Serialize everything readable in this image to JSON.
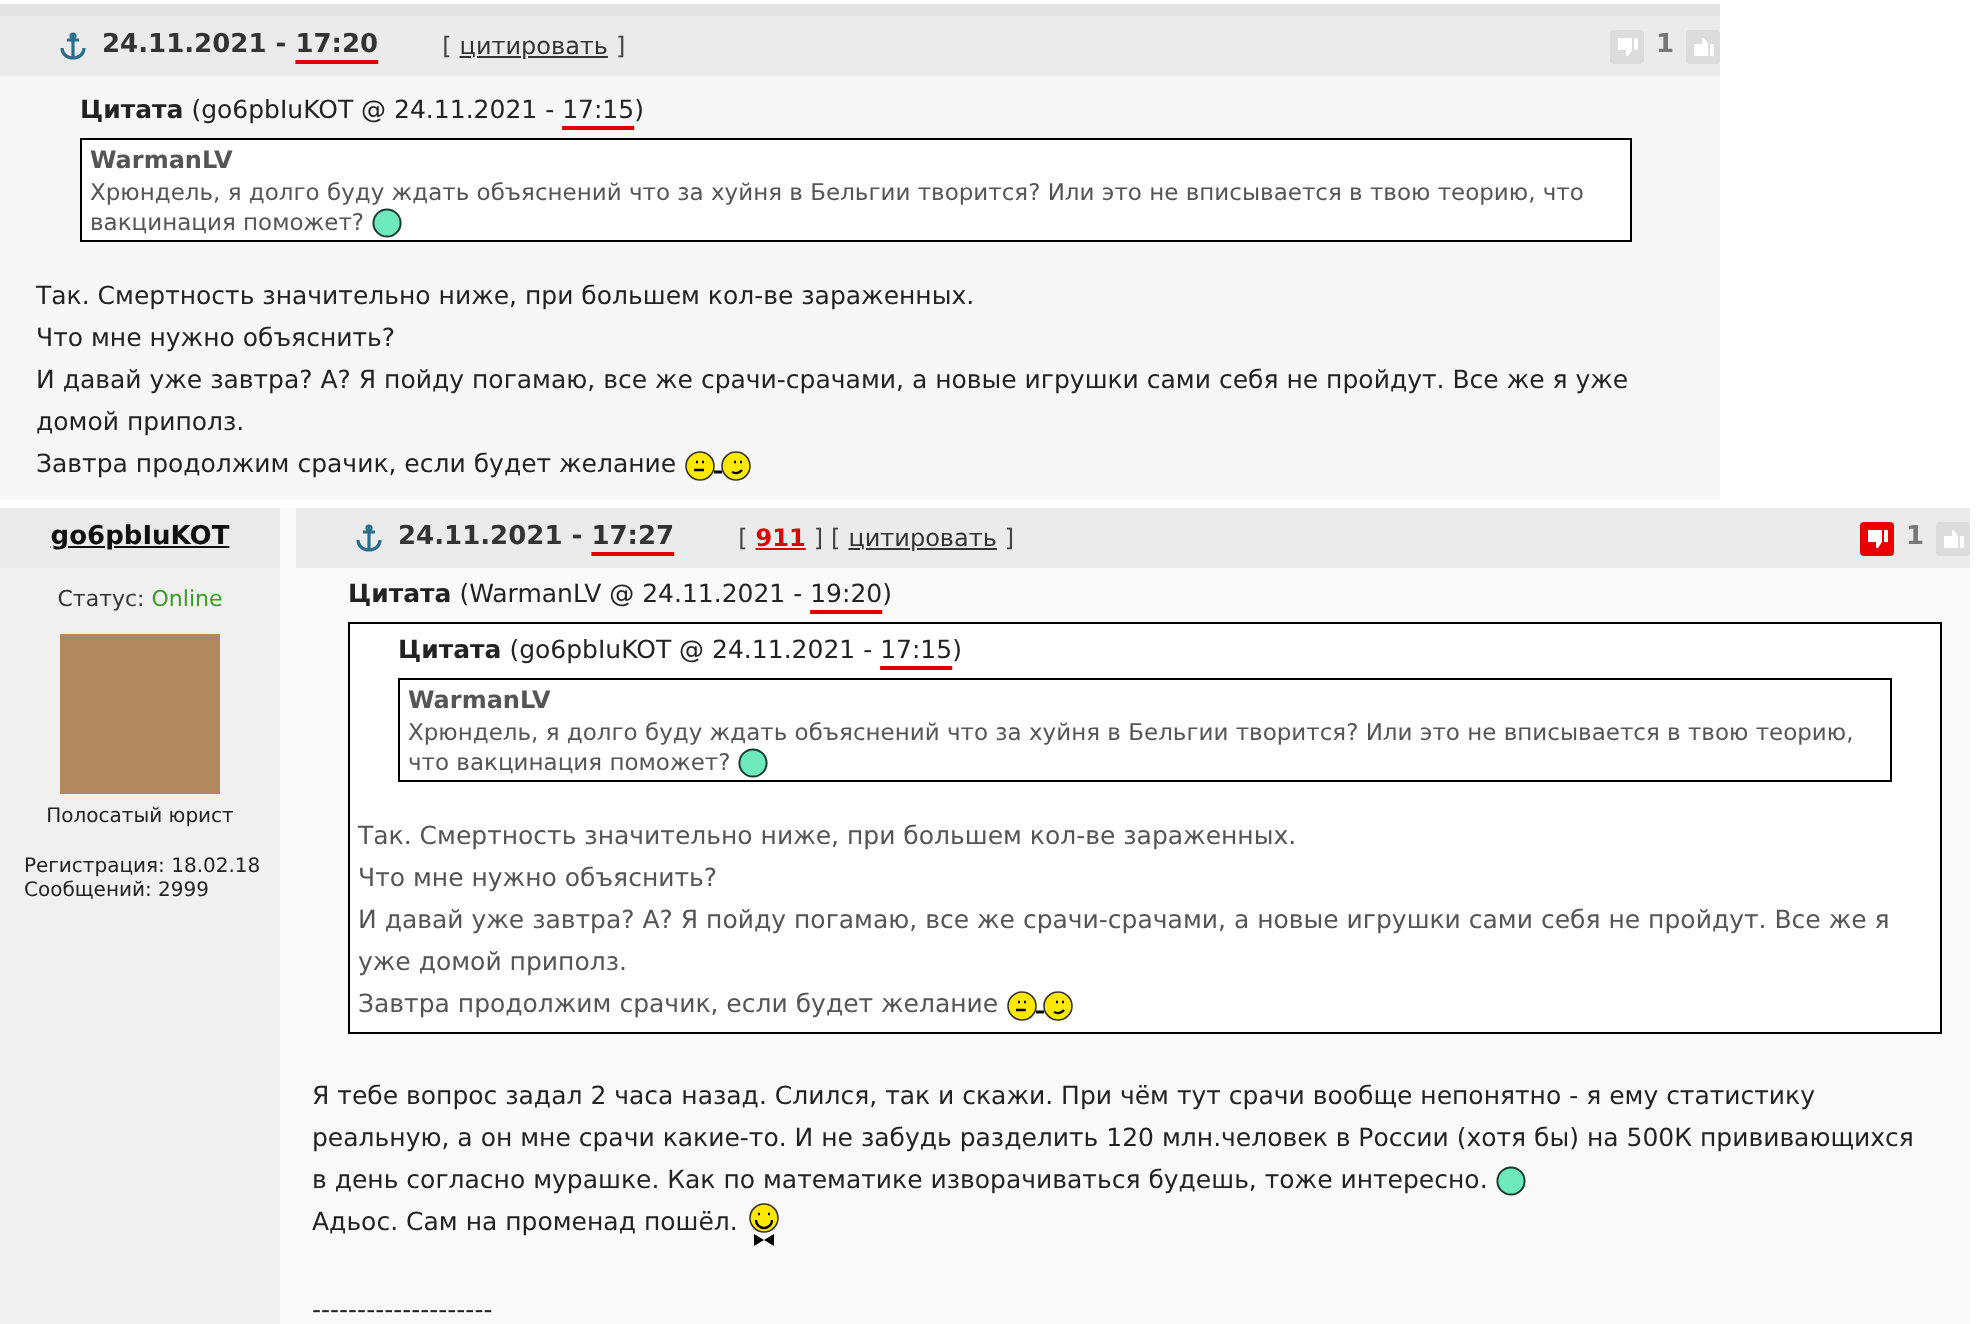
{
  "posts": [
    {
      "date": "24.11.2021 -",
      "time": "17:20",
      "actions": [
        {
          "before": "[",
          "label": "цитировать",
          "after": "]",
          "kind": "quote"
        }
      ],
      "disliked": false,
      "rating": "1",
      "quote": {
        "label": "Цитата",
        "attribution_start": "(go6pbIuKOT @ 24.11.2021 - ",
        "time": "17:15",
        "attribution_end": ")",
        "box": {
          "author": "WarmanLV",
          "lines": [
            {
              "text": "Хрюндель, я долго буду ждать объяснений что за хуйня в Бельгии творится? Или это не вписывается в твою теорию, что вакцинация поможет?",
              "emoticon": {
                "kind": "round"
              }
            }
          ]
        }
      },
      "body": [
        {
          "text": "Так. Смертность значительно ниже, при большем кол-ве зараженных."
        },
        {
          "text": "Что мне нужно объяснить?"
        },
        {
          "text": "И давай уже завтра? А? Я пойду погамаю, все же срачи-срачами, а новые игрушки сами себя не пройдут. Все же я уже домой приполз."
        },
        {
          "text": "Завтра продолжим срачик, если будет желание",
          "emoticon": {
            "kind": "two_faces"
          }
        }
      ]
    },
    {
      "author": {
        "name": "go6pbIuKOT",
        "status_label": "Статус:",
        "status": "Online",
        "title": "Полосатый юрист",
        "registration": "Регистрация: 18.02.18",
        "posts": "Сообщений: 2999"
      },
      "date": "24.11.2021 -",
      "time": "17:27",
      "actions": [
        {
          "before": "[",
          "label": "911",
          "after": "]",
          "kind": "count"
        },
        {
          "before": "[",
          "label": "цитировать",
          "after": "]",
          "kind": "quote"
        }
      ],
      "disliked": true,
      "rating": "1",
      "quote": {
        "label": "Цитата",
        "attribution_start": "(WarmanLV @ 24.11.2021 - ",
        "time": "19:20",
        "attribution_end": ")",
        "box": {
          "quote": {
            "label": "Цитата",
            "attribution_start": "(go6pbIuKOT @ 24.11.2021 - ",
            "time": "17:15",
            "attribution_end": ")",
            "box": {
              "author": "WarmanLV",
              "lines": [
                {
                  "text": "Хрюндель, я долго буду ждать объяснений что за хуйня в Бельгии творится? Или это не вписывается в твою теорию, что вакцинация поможет?",
                  "emoticon": {
                    "kind": "round"
                  }
                }
              ]
            }
          },
          "lines": [
            {
              "text": "Так. Смертность значительно ниже, при большем кол-ве зараженных."
            },
            {
              "text": "Что мне нужно объяснить?"
            },
            {
              "text": "И давай уже завтра? А? Я пойду погамаю, все же срачи-срачами, а новые игрушки сами себя не пройдут. Все же я уже домой приполз."
            },
            {
              "text": "Завтра продолжим срачик, если будет желание",
              "emoticon": {
                "kind": "two_faces"
              }
            }
          ]
        }
      },
      "body": [
        {
          "text": "Я тебе вопрос задал 2 часа назад. Слился, так и скажи. При чём тут срачи вообще непонятно - я ему статистику реальную, а он мне срачи какие-то. И не забудь разделить 120 млн.человек в России (хотя бы) на 500К прививающихся в день согласно мурашке. Как по математике изворачиваться будешь, тоже интересно.",
          "emoticon": {
            "kind": "round"
          }
        },
        {
          "text": "Адьос. Сам на променад пошёл.",
          "emoticon": {
            "kind": "bowtie"
          }
        }
      ],
      "signature": "--------------------"
    }
  ]
}
